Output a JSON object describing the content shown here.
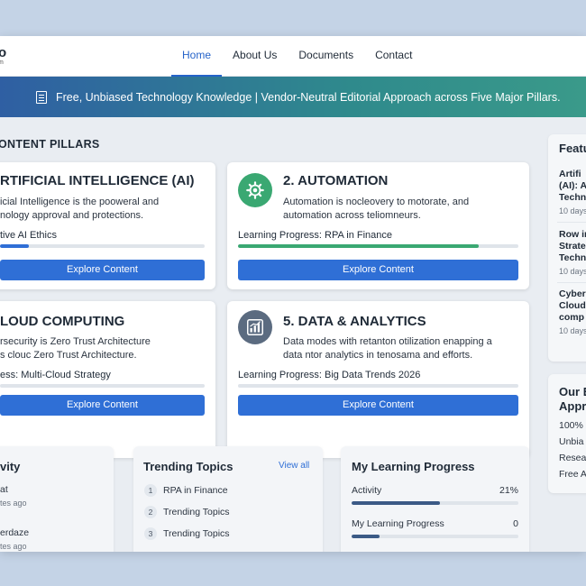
{
  "nav": {
    "logo_main": "o",
    "logo_sub": "m",
    "links": [
      "Home",
      "About Us",
      "Documents",
      "Contact"
    ]
  },
  "banner": {
    "text": "Free, Unbiased Technology Knowledge | Vendor-Neutral Editorial Approach across Five Major Pillars."
  },
  "content": {
    "section_title": "ONTENT PILLARS",
    "pillars": [
      {
        "title": "RTIFICIAL INTELLIGENCE (AI)",
        "desc_lines": [
          "icial Intelligence is the pooweral and",
          "nology approval and protections."
        ],
        "progress_label": "tive AI Ethics",
        "progress": 0.14,
        "button": "Explore Content",
        "color": "#2f6fd6"
      },
      {
        "title": "2. AUTOMATION",
        "desc_lines": [
          "Automation is nocleovery to motorate, and",
          "automation across teliomneurs."
        ],
        "progress_label": "Learning Progress: RPA in Finance",
        "progress": 0.86,
        "button": "Explore Content",
        "color": "#3aa872"
      },
      {
        "title": "LOUD COMPUTING",
        "desc_lines": [
          "rsecurity is Zero Trust Architecture",
          "s clouc Zero Trust Architecture."
        ],
        "progress_label": "ess: Multi-Cloud Strategy",
        "progress": 0.0,
        "button": "Explore Content",
        "color": "#2f6fd6"
      },
      {
        "title": "5. DATA & ANALYTICS",
        "desc_lines": [
          "Data modes with retanton otilization enapping a",
          "data ntor analytics in tenosama and efforts."
        ],
        "progress_label": "Learning Progress: Big Data Trends 2026",
        "progress": 0.0,
        "button": "Explore Content",
        "color": "#2f6fd6"
      }
    ]
  },
  "activity": {
    "title": "vity",
    "items": [
      {
        "title": "at",
        "time": "tes ago"
      },
      {
        "title": "erdaze",
        "time": "tes ago"
      }
    ]
  },
  "trending": {
    "title": "Trending Topics",
    "view_all": "View all",
    "items": [
      {
        "rank": "1",
        "label": "RPA in Finance"
      },
      {
        "rank": "2",
        "label": "Trending Topics"
      },
      {
        "rank": "3",
        "label": "Trending Topics"
      }
    ]
  },
  "learning": {
    "title": "My Learning Progress",
    "items": [
      {
        "label": "Activity",
        "value": "21%",
        "progress": 0.5
      },
      {
        "label": "My Learning Progress",
        "value": "0",
        "progress": 0.17
      }
    ]
  },
  "featured": {
    "title": "Featu",
    "items": [
      {
        "lines": [
          "Artifi",
          "(AI): A",
          "Techn"
        ],
        "time": "10 days"
      },
      {
        "lines": [
          "Row in",
          "Strate",
          "Techn"
        ],
        "time": "10 days"
      },
      {
        "lines": [
          "Cyber",
          "Cloud",
          "comp"
        ],
        "time": "10 days"
      }
    ]
  },
  "approach": {
    "title_lines": [
      "Our E",
      "Appro"
    ],
    "items": [
      "100%",
      "Unbia",
      "Resea",
      "Free A"
    ]
  },
  "colors": {
    "accent": "#2f6fd6",
    "green": "#3aa872",
    "banner_start": "#2f5fa3",
    "banner_end": "#3a9a8a"
  }
}
